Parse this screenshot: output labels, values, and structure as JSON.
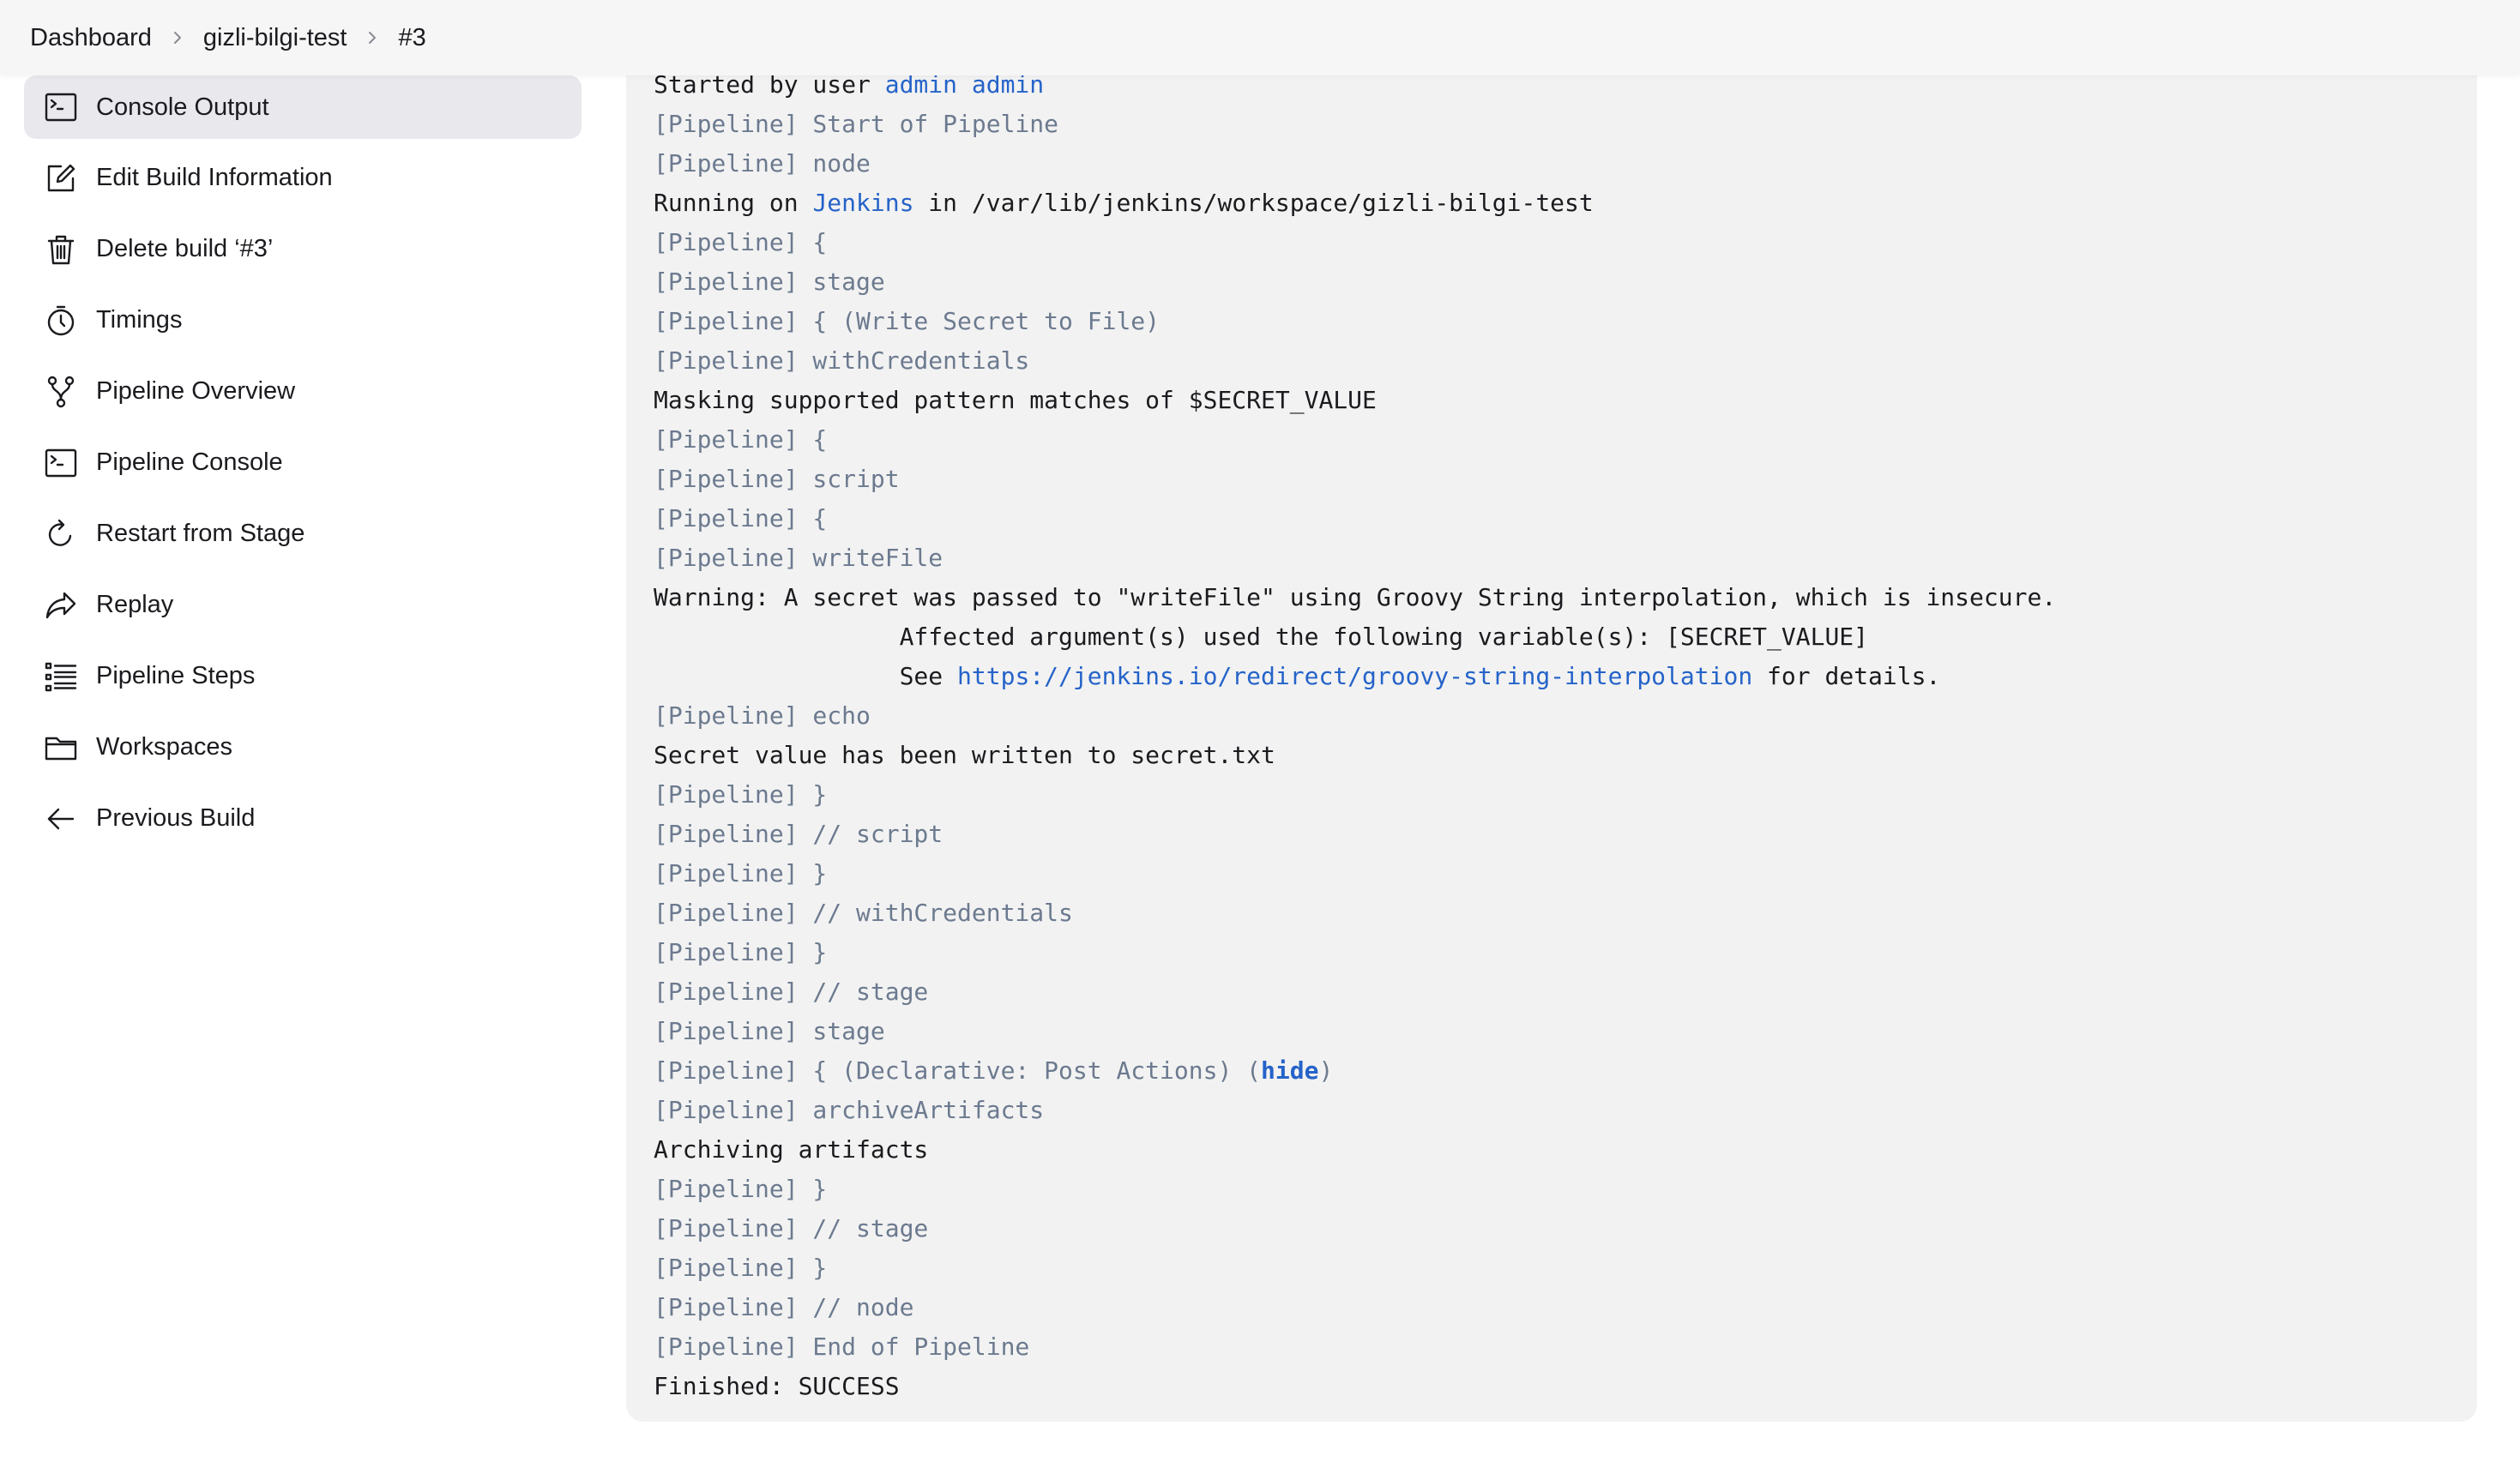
{
  "breadcrumb": {
    "items": [
      "Dashboard",
      "gizli-bilgi-test",
      "#3"
    ]
  },
  "sidebar": {
    "items": [
      {
        "label": "Console Output",
        "icon": "terminal-icon",
        "active": true
      },
      {
        "label": "Edit Build Information",
        "icon": "edit-icon"
      },
      {
        "label": "Delete build ‘#3’",
        "icon": "trash-icon"
      },
      {
        "label": "Timings",
        "icon": "stopwatch-icon"
      },
      {
        "label": "Pipeline Overview",
        "icon": "branch-icon"
      },
      {
        "label": "Pipeline Console",
        "icon": "terminal-icon"
      },
      {
        "label": "Restart from Stage",
        "icon": "refresh-icon"
      },
      {
        "label": "Replay",
        "icon": "share-icon"
      },
      {
        "label": "Pipeline Steps",
        "icon": "list-icon"
      },
      {
        "label": "Workspaces",
        "icon": "folder-icon"
      },
      {
        "label": "Previous Build",
        "icon": "arrow-left-icon"
      }
    ]
  },
  "console": {
    "started_prefix": "Started by user ",
    "started_user": "admin admin",
    "line_start_pipeline": "[Pipeline] Start of Pipeline",
    "line_node": "[Pipeline] node",
    "running_prefix": "Running on ",
    "running_agent": "Jenkins",
    "running_suffix": " in /var/lib/jenkins/workspace/gizli-bilgi-test",
    "line_open1": "[Pipeline] {",
    "line_stage1": "[Pipeline] stage",
    "line_write_stage": "[Pipeline] { (Write Secret to File)",
    "line_withcred": "[Pipeline] withCredentials",
    "line_masking": "Masking supported pattern matches of $SECRET_VALUE",
    "line_open2": "[Pipeline] {",
    "line_script": "[Pipeline] script",
    "line_open3": "[Pipeline] {",
    "line_writefile": "[Pipeline] writeFile",
    "line_warning": "Warning: A secret was passed to \"writeFile\" using Groovy String interpolation, which is insecure.",
    "line_affected": "\t\t Affected argument(s) used the following variable(s): [SECRET_VALUE]",
    "see_prefix": "\t\t See ",
    "see_link": "https://jenkins.io/redirect/groovy-string-interpolation",
    "see_suffix": " for details.",
    "line_echo": "[Pipeline] echo",
    "line_secret_written": "Secret value has been written to secret.txt",
    "line_close1": "[Pipeline] }",
    "line_end_script": "[Pipeline] // script",
    "line_close2": "[Pipeline] }",
    "line_end_withcred": "[Pipeline] // withCredentials",
    "line_close3": "[Pipeline] }",
    "line_end_stage1": "[Pipeline] // stage",
    "line_stage2": "[Pipeline] stage",
    "post_prefix": "[Pipeline] { (Declarative: Post Actions) (",
    "post_hide": "hide",
    "post_suffix": ")",
    "line_archive": "[Pipeline] archiveArtifacts",
    "line_archiving": "Archiving artifacts",
    "line_close4": "[Pipeline] }",
    "line_end_stage2": "[Pipeline] // stage",
    "line_close5": "[Pipeline] }",
    "line_end_node": "[Pipeline] // node",
    "line_end_pipeline": "[Pipeline] End of Pipeline",
    "line_finished": "Finished: SUCCESS"
  }
}
